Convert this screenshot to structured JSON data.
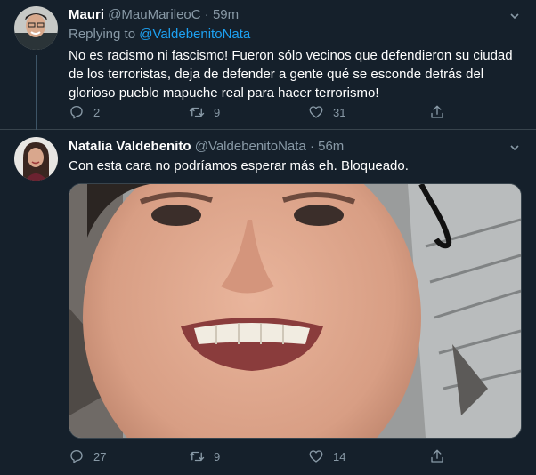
{
  "tweet1": {
    "name": "Mauri",
    "handle": "@MauMarileoC",
    "time": "· 59m",
    "replying_prefix": "Replying to",
    "replying_to": "@ValdebenitoNata",
    "text": "No es racismo ni fascismo! Fueron sólo vecinos que defendieron su ciudad de los terroristas, deja de defender a gente qué se esconde detrás del glorioso pueblo mapuche real para hacer terrorismo!",
    "replies": "2",
    "retweets": "9",
    "likes": "31"
  },
  "tweet2": {
    "name": "Natalia Valdebenito",
    "handle": "@ValdebenitoNata",
    "time": "· 56m",
    "text": "Con esta cara no podríamos esperar más eh. Bloqueado.",
    "replies": "27",
    "retweets": "9",
    "likes": "14"
  },
  "icons": [
    "chevron-down-icon",
    "reply-icon",
    "retweet-icon",
    "like-icon",
    "share-icon"
  ],
  "colors": {
    "background": "#15202b",
    "secondary_text": "#8899a6",
    "link": "#1da1f2",
    "divider": "#38444d"
  }
}
